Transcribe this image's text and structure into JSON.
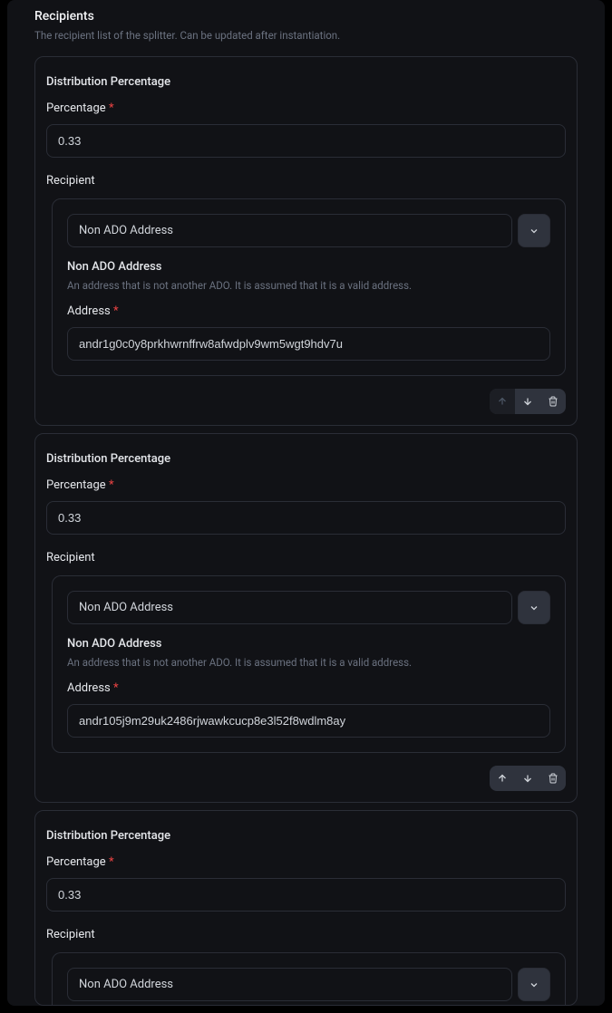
{
  "section": {
    "title": "Recipients",
    "description": "The recipient list of the splitter. Can be updated after instantiation."
  },
  "labels": {
    "distributionHeading": "Distribution Percentage",
    "percentageLabel": "Percentage",
    "recipientLabel": "Recipient",
    "nonAdoHeading": "Non ADO Address",
    "nonAdoDesc": "An address that is not another ADO. It is assumed that it is a valid address.",
    "addressLabel": "Address",
    "selectValue": "Non ADO Address",
    "requiredMark": "*"
  },
  "recipients": [
    {
      "percentage": "0.33",
      "address": "andr1g0c0y8prkhwrnffrw8afwdplv9wm5wgt9hdv7u",
      "upDisabled": true,
      "downDisabled": false
    },
    {
      "percentage": "0.33",
      "address": "andr105j9m29uk2486rjwawkcucp8e3l52f8wdlm8ay",
      "upDisabled": false,
      "downDisabled": false
    },
    {
      "percentage": "0.33",
      "address": "",
      "upDisabled": false,
      "downDisabled": false
    }
  ]
}
